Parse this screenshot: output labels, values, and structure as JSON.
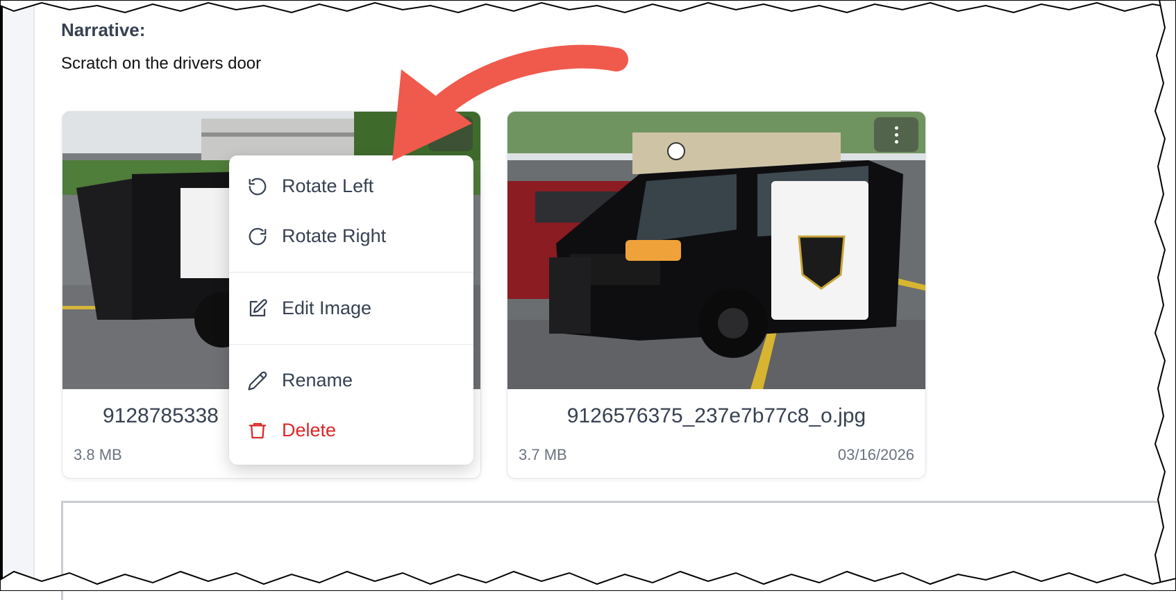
{
  "narrative": {
    "label": "Narrative:",
    "text": "Scratch on the drivers door"
  },
  "attachments": [
    {
      "file_name": "9128785338",
      "size": "3.8 MB",
      "image": "police-suv-doors-open-photo"
    },
    {
      "file_name": "9126576375_237e7b77c8_o.jpg",
      "size": "3.7 MB",
      "date": "03/16/2026",
      "image": "police-suv-supervisor-photo"
    }
  ],
  "context_menu": {
    "items": [
      {
        "label": "Rotate Left",
        "icon": "rotate-left-icon"
      },
      {
        "label": "Rotate Right",
        "icon": "rotate-right-icon"
      },
      {
        "label": "Edit Image",
        "icon": "edit-icon"
      },
      {
        "label": "Rename",
        "icon": "pencil-icon"
      },
      {
        "label": "Delete",
        "icon": "trash-icon",
        "color": "#dc2626"
      }
    ]
  },
  "colors": {
    "annotation_arrow": "#ef5a4c",
    "danger": "#dc2626",
    "text_muted": "#6b7280"
  }
}
